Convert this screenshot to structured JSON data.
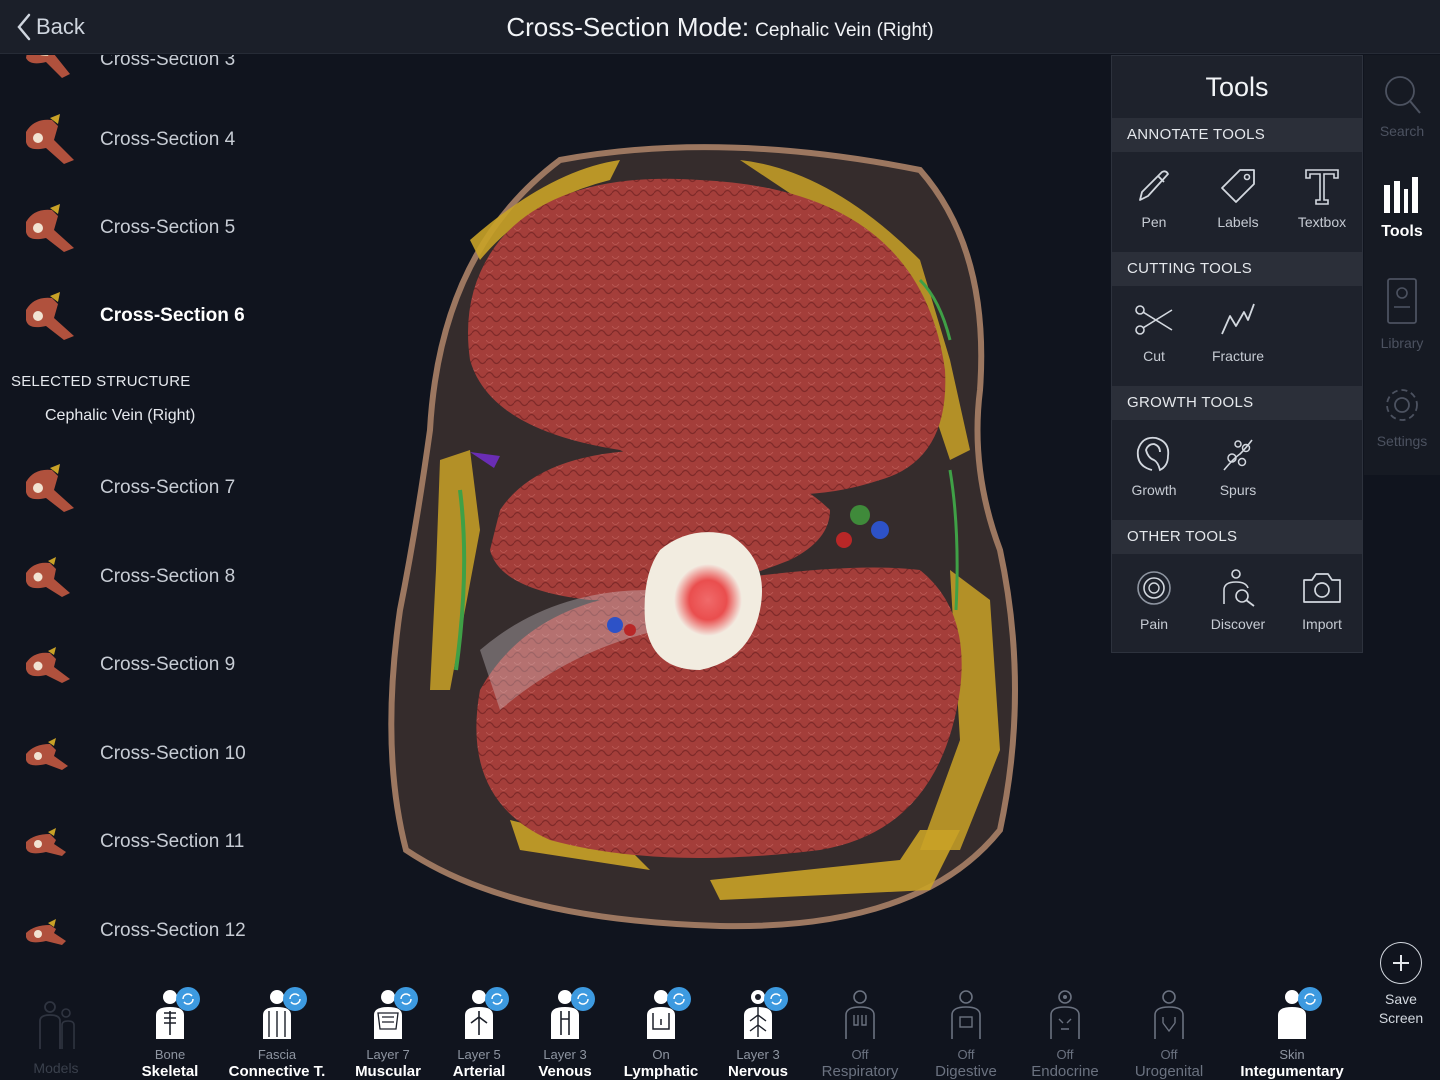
{
  "header": {
    "back_label": "Back",
    "title": "Cross-Section Mode:",
    "subtitle": "Cephalic Vein (Right)"
  },
  "cross_sections": [
    {
      "label": "Cross-Section 3",
      "active": false
    },
    {
      "label": "Cross-Section 4",
      "active": false
    },
    {
      "label": "Cross-Section 5",
      "active": false
    },
    {
      "label": "Cross-Section 6",
      "active": true
    },
    {
      "label": "Cross-Section 7",
      "active": false
    },
    {
      "label": "Cross-Section 8",
      "active": false
    },
    {
      "label": "Cross-Section 9",
      "active": false
    },
    {
      "label": "Cross-Section 10",
      "active": false
    },
    {
      "label": "Cross-Section 11",
      "active": false
    },
    {
      "label": "Cross-Section 12",
      "active": false
    }
  ],
  "selected": {
    "heading": "SELECTED STRUCTURE",
    "value": "Cephalic Vein (Right)"
  },
  "tools_panel": {
    "title": "Tools",
    "sections": [
      {
        "heading": "ANNOTATE TOOLS",
        "tools": [
          {
            "label": "Pen",
            "icon": "pen-icon"
          },
          {
            "label": "Labels",
            "icon": "tag-icon"
          },
          {
            "label": "Textbox",
            "icon": "textbox-icon"
          }
        ]
      },
      {
        "heading": "CUTTING TOOLS",
        "tools": [
          {
            "label": "Cut",
            "icon": "scissors-icon"
          },
          {
            "label": "Fracture",
            "icon": "fracture-icon"
          }
        ]
      },
      {
        "heading": "GROWTH TOOLS",
        "tools": [
          {
            "label": "Growth",
            "icon": "growth-icon"
          },
          {
            "label": "Spurs",
            "icon": "spurs-icon"
          }
        ]
      },
      {
        "heading": "OTHER TOOLS",
        "tools": [
          {
            "label": "Pain",
            "icon": "pain-icon"
          },
          {
            "label": "Discover",
            "icon": "discover-icon"
          },
          {
            "label": "Import",
            "icon": "camera-icon"
          }
        ]
      }
    ]
  },
  "rail": [
    {
      "label": "Search",
      "icon": "search-icon",
      "active": false
    },
    {
      "label": "Tools",
      "icon": "tools-icon",
      "active": true
    },
    {
      "label": "Library",
      "icon": "library-icon",
      "active": false
    },
    {
      "label": "Settings",
      "icon": "gear-icon",
      "active": false
    }
  ],
  "save_screen": {
    "line1": "Save",
    "line2": "Screen"
  },
  "models_label": "Models",
  "systems": [
    {
      "level": "Bone",
      "name": "Skeletal",
      "on": true
    },
    {
      "level": "Fascia",
      "name": "Connective T.",
      "on": true
    },
    {
      "level": "Layer 7",
      "name": "Muscular",
      "on": true
    },
    {
      "level": "Layer 5",
      "name": "Arterial",
      "on": true
    },
    {
      "level": "Layer 3",
      "name": "Venous",
      "on": true
    },
    {
      "level": "On",
      "name": "Lymphatic",
      "on": true
    },
    {
      "level": "Layer 3",
      "name": "Nervous",
      "on": true
    },
    {
      "level": "Off",
      "name": "Respiratory",
      "on": false
    },
    {
      "level": "Off",
      "name": "Digestive",
      "on": false
    },
    {
      "level": "Off",
      "name": "Endocrine",
      "on": false
    },
    {
      "level": "Off",
      "name": "Urogenital",
      "on": false
    },
    {
      "level": "Skin",
      "name": "Integumentary",
      "on": true
    }
  ],
  "colors": {
    "accent_badge": "#3d9ae0",
    "muscle": "#a8403c",
    "fat": "#c9a227",
    "background": "#10141e"
  }
}
